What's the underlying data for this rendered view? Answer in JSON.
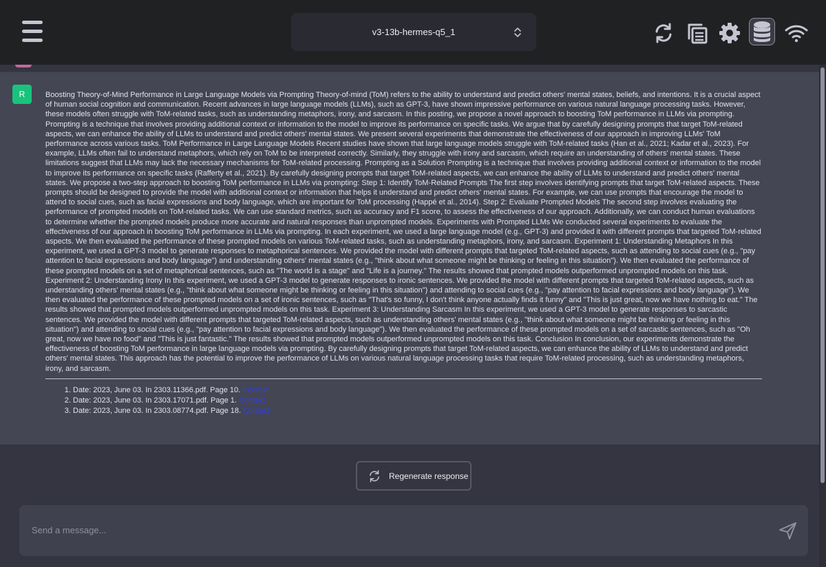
{
  "header": {
    "model": "v3-13b-hermes-q5_1",
    "icons": [
      "menu-icon",
      "chevron-updown-icon",
      "refresh-icon",
      "copy-icon",
      "gear-icon",
      "database-icon",
      "wifi-icon"
    ]
  },
  "message": {
    "avatar_letter": "R",
    "text": "Boosting Theory-of-Mind Performance in Large Language Models via Prompting Theory-of-mind (ToM) refers to the ability to understand and predict others' mental states, beliefs, and intentions. It is a crucial aspect of human social cognition and communication. Recent advances in large language models (LLMs), such as GPT-3, have shown impressive performance on various natural language processing tasks. However, these models often struggle with ToM-related tasks, such as understanding metaphors, irony, and sarcasm. In this posting, we propose a novel approach to boosting ToM performance in LLMs via prompting. Prompting is a technique that involves providing additional context or information to the model to improve its performance on specific tasks. We argue that by carefully designing prompts that target ToM-related aspects, we can enhance the ability of LLMs to understand and predict others' mental states. We present several experiments that demonstrate the effectiveness of our approach in improving LLMs' ToM performance across various tasks. ToM Performance in Large Language Models Recent studies have shown that large language models struggle with ToM-related tasks (Han et al., 2021; Kadar et al., 2023). For example, LLMs often fail to understand metaphors, which rely on ToM to be interpreted correctly. Similarly, they struggle with irony and sarcasm, which require an understanding of others' mental states. These limitations suggest that LLMs may lack the necessary mechanisms for ToM-related processing. Prompting as a Solution Prompting is a technique that involves providing additional context or information to the model to improve its performance on specific tasks (Rafferty et al., 2021). By carefully designing prompts that target ToM-related aspects, we can enhance the ability of LLMs to understand and predict others' mental states. We propose a two-step approach to boosting ToM performance in LLMs via prompting: Step 1: Identify ToM-Related Prompts The first step involves identifying prompts that target ToM-related aspects. These prompts should be designed to provide the model with additional context or information that helps it understand and predict others' mental states. For example, we can use prompts that encourage the model to attend to social cues, such as facial expressions and body language, which are important for ToM processing (Happé et al., 2014). Step 2: Evaluate Prompted Models The second step involves evaluating the performance of prompted models on ToM-related tasks. We can use standard metrics, such as accuracy and F1 score, to assess the effectiveness of our approach. Additionally, we can conduct human evaluations to determine whether the prompted models produce more accurate and natural responses than unprompted models. Experiments with Prompted LLMs We conducted several experiments to evaluate the effectiveness of our approach in boosting ToM performance in LLMs via prompting. In each experiment, we used a large language model (e.g., GPT-3) and provided it with different prompts that targeted ToM-related aspects. We then evaluated the performance of these prompted models on various ToM-related tasks, such as understanding metaphors, irony, and sarcasm. Experiment 1: Understanding Metaphors In this experiment, we used a GPT-3 model to generate responses to metaphorical sentences. We provided the model with different prompts that targeted ToM-related aspects, such as attending to social cues (e.g., \"pay attention to facial expressions and body language\") and understanding others' mental states (e.g., \"think about what someone might be thinking or feeling in this situation\"). We then evaluated the performance of these prompted models on a set of metaphorical sentences, such as \"The world is a stage\" and \"Life is a journey.\" The results showed that prompted models outperformed unprompted models on this task. Experiment 2: Understanding Irony In this experiment, we used a GPT-3 model to generate responses to ironic sentences. We provided the model with different prompts that targeted ToM-related aspects, such as understanding others' mental states (e.g., \"think about what someone might be thinking or feeling in this situation\") and attending to social cues (e.g., \"pay attention to facial expressions and body language\"). We then evaluated the performance of these prompted models on a set of ironic sentences, such as \"That's so funny, I don't think anyone actually finds it funny\" and \"This is just great, now we have nothing to eat.\" The results showed that prompted models outperformed unprompted models on this task. Experiment 3: Understanding Sarcasm In this experiment, we used a GPT-3 model to generate responses to sarcastic sentences. We provided the model with different prompts that targeted ToM-related aspects, such as understanding others' mental states (e.g., \"think about what someone might be thinking or feeling in this situation\") and attending to social cues (e.g., \"pay attention to facial expressions and body language\"). We then evaluated the performance of these prompted models on a set of sarcastic sentences, such as \"Oh great, now we have no food\" and \"This is just fantastic.\" The results showed that prompted models outperformed unprompted models on this task. Conclusion In conclusion, our experiments demonstrate the effectiveness of boosting ToM performance in large language models via prompting. By carefully designing prompts that target ToM-related aspects, we can enhance the ability of LLMs to understand and predict others' mental states. This approach has the potential to improve the performance of LLMs on various natural language processing tasks that require ToM-related processing, such as understanding metaphors, irony, and sarcasm.",
    "sources": [
      {
        "text": "Date: 2023, June 03. In 2303.11366.pdf. Page 10.",
        "link": "Context"
      },
      {
        "text": "Date: 2023, June 03. In 2303.17071.pdf. Page 1.",
        "link": "Context"
      },
      {
        "text": "Date: 2023, June 03. In 2303.08774.pdf. Page 18.",
        "link": "Context"
      }
    ]
  },
  "regenerate_label": "Regenerate response",
  "input": {
    "placeholder": "Send a message...",
    "value": ""
  },
  "colors": {
    "background": "#343541",
    "topbar": "#202123",
    "message_bg": "#444654",
    "avatar": "#19c37d",
    "link": "#2d3bff"
  }
}
